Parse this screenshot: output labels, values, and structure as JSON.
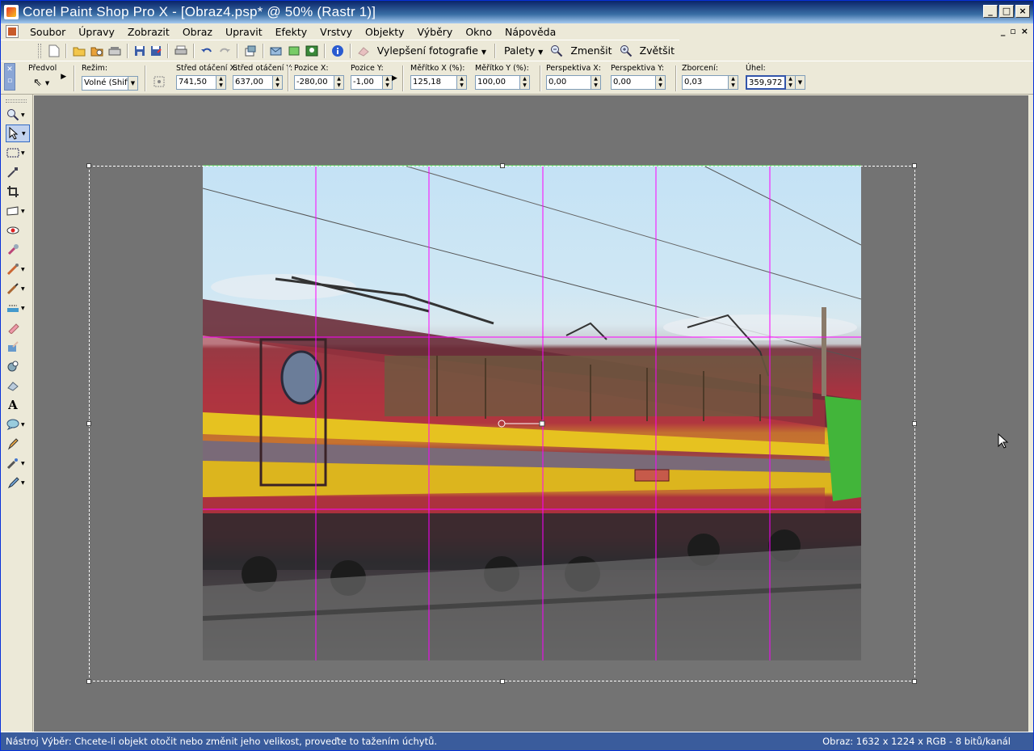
{
  "window": {
    "title": "Corel Paint Shop Pro X - [Obraz4.psp* @  50% (Rastr 1)]",
    "controls": {
      "minimize": "_",
      "maximize": "□",
      "close": "×"
    }
  },
  "menu": {
    "items": [
      "Soubor",
      "Úpravy",
      "Zobrazit",
      "Obraz",
      "Upravit",
      "Efekty",
      "Vrstvy",
      "Objekty",
      "Výběry",
      "Okno",
      "Nápověda"
    ],
    "mdi_controls": [
      "_",
      "▫",
      "×"
    ]
  },
  "toolbar": {
    "photo_fix": "Vylepšení fotografie",
    "palettes": "Palety",
    "zoom_out": "Zmenšit",
    "zoom_in": "Zvětšit"
  },
  "options": {
    "preset_label": "Předvol",
    "mode_label": "Režim:",
    "mode_value": "Volné (Shift",
    "rot_center_x_label": "Střed otáčení X:",
    "rot_center_x": "741,50",
    "rot_center_y_label": "Střed otáčení Y:",
    "rot_center_y": "637,00",
    "pos_x_label": "Pozice X:",
    "pos_x": "-280,00",
    "pos_y_label": "Pozice Y:",
    "pos_y": "-1,00",
    "scale_x_label": "Měřítko X (%):",
    "scale_x": "125,18",
    "scale_y_label": "Měřítko Y (%):",
    "scale_y": "100,00",
    "persp_x_label": "Perspektiva X:",
    "persp_x": "0,00",
    "persp_y_label": "Perspektiva Y:",
    "persp_y": "0,00",
    "skew_label": "Zborcení:",
    "skew": "0,03",
    "angle_label": "Úhel:",
    "angle": "359,972"
  },
  "tools": [
    "zoom-icon",
    "pick-icon",
    "selection-icon",
    "dropper-icon",
    "crop-icon",
    "straighten-icon",
    "red-eye-icon",
    "clone-icon",
    "scratch-remover-icon",
    "paint-brush-icon",
    "fill-icon",
    "eraser-icon",
    "retouch-icon",
    "picture-tube-icon",
    "object-remover-icon",
    "text-icon",
    "preset-shape-icon",
    "pen-icon",
    "airbrush-icon",
    "pencil-icon"
  ],
  "status": {
    "hint": "Nástroj Výběr: Chcete-li objekt otočit nebo změnit jeho velikost, proveďte to tažením úchytů.",
    "image_info": "Obraz:  1632 x 1224 x RGB - 8 bitů/kanál"
  },
  "colors": {
    "guide": "#ff00ff",
    "workspace": "#737373",
    "status_bar": "#3a5c9c"
  }
}
